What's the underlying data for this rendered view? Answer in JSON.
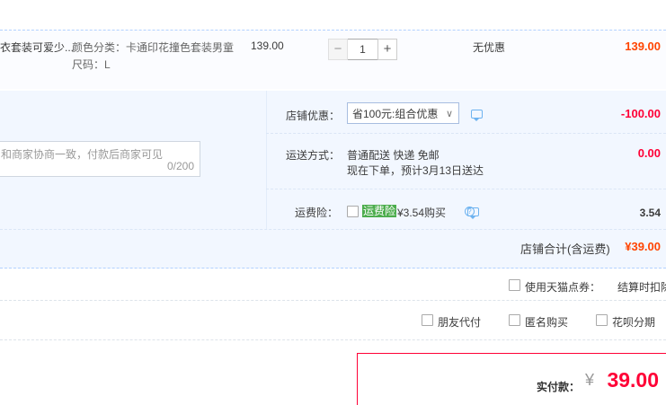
{
  "product": {
    "title": "衣套装可爱少...",
    "color_attr": "颜色分类：卡通印花撞色套装男童",
    "size_attr": "尺码：L",
    "unit_price": "139.00",
    "quantity": "1",
    "minus": "−",
    "plus": "+",
    "discount": "无优惠",
    "total": "139.00"
  },
  "store_discount": {
    "label": "店铺优惠：",
    "selected": "省100元:组合优惠",
    "chevron": "∨",
    "amount": "-100.00"
  },
  "message": {
    "placeholder": "和商家协商一致，付款后商家可见",
    "counter": "0/200"
  },
  "shipping": {
    "label": "运送方式：",
    "method": "普通配送 快递 免邮",
    "eta": "现在下单，预计3月13日送达",
    "amount": "0.00"
  },
  "insurance": {
    "label": "运费险：",
    "badge": "运费险",
    "price_text": "¥3.54购买",
    "help": "?",
    "amount": "3.54"
  },
  "store_total": {
    "label": "店铺合计(含运费)",
    "value": "¥39.00"
  },
  "coupon": {
    "label": "使用天猫点券：",
    "note": "结算时扣除"
  },
  "options": {
    "friend_pay": "朋友代付",
    "anonymous": "匿名购买",
    "huabei": "花呗分期"
  },
  "payment": {
    "label": "实付款：",
    "currency": "¥",
    "amount": "39.00"
  },
  "colors": {
    "accent_red": "#ff0036",
    "price_orange": "#ff4400",
    "link_blue": "#6eb3f0",
    "panel_bg": "#f2f7ff",
    "badge_green": "#4cad4d"
  }
}
